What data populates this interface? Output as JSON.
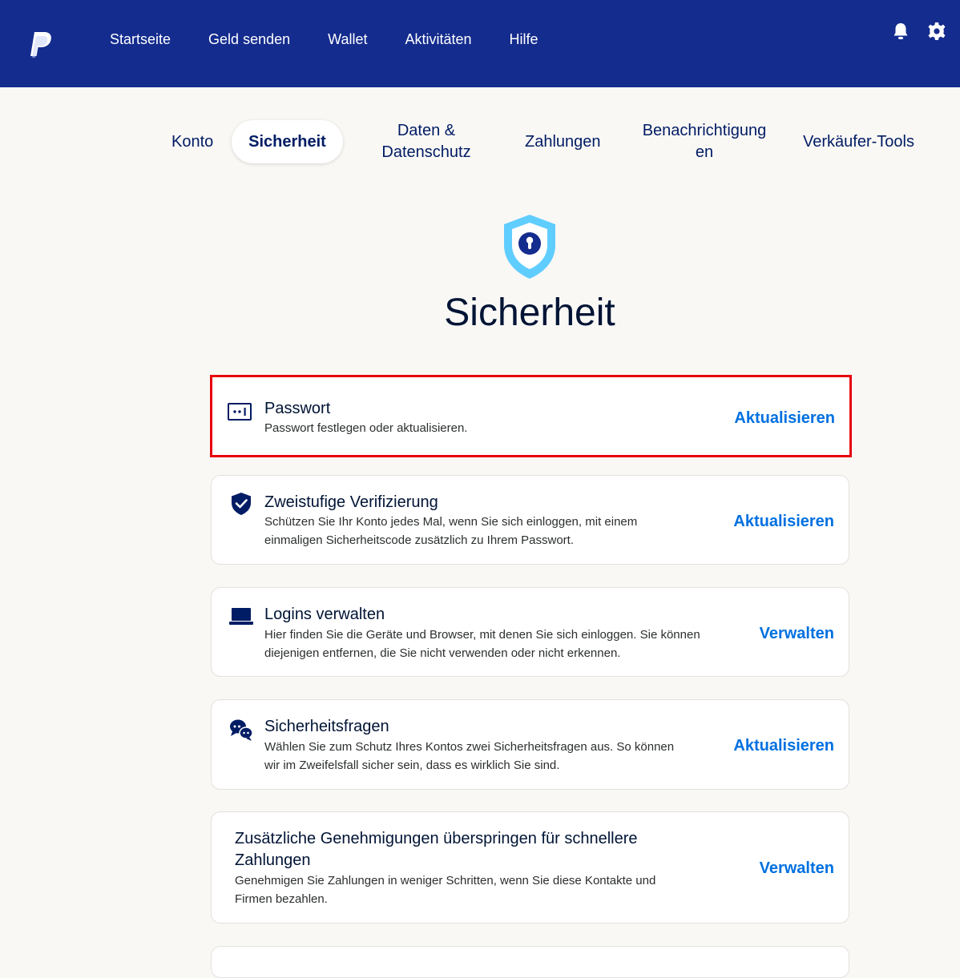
{
  "nav": {
    "items": [
      "Startseite",
      "Geld senden",
      "Wallet",
      "Aktivitäten",
      "Hilfe"
    ],
    "icons": [
      "bell-icon",
      "gear-icon"
    ]
  },
  "tabs": {
    "konto": "Konto",
    "sicherheit": "Sicherheit",
    "daten_line1": "Daten &",
    "daten_line2": "Datenschutz",
    "zahlungen": "Zahlungen",
    "benach_line1": "Benachrichtigung",
    "benach_line2": "en",
    "verkaeufer": "Verkäufer-Tools"
  },
  "hero": {
    "title": "Sicherheit",
    "icon": "shield-keyhole-icon"
  },
  "cards": [
    {
      "title": "Passwort",
      "desc": [
        "Passwort festlegen oder aktualisieren."
      ],
      "action": "Aktualisieren",
      "icon": "password-icon"
    },
    {
      "title": "Zweistufige Verifizierung",
      "desc": [
        "Schützen Sie Ihr Konto jedes Mal, wenn Sie sich einloggen, mit einem",
        "einmaligen Sicherheitscode zusätzlich zu Ihrem Passwort."
      ],
      "action": "Aktualisieren",
      "icon": "shield-check-icon"
    },
    {
      "title": "Logins verwalten",
      "desc": [
        "Hier finden Sie die Geräte und Browser, mit denen Sie sich einloggen. Sie können",
        "diejenigen entfernen, die Sie nicht verwenden oder nicht erkennen."
      ],
      "action": "Verwalten",
      "icon": "laptop-icon"
    },
    {
      "title": "Sicherheitsfragen",
      "desc": [
        "Wählen Sie zum Schutz Ihres Kontos zwei Sicherheitsfragen aus. So können",
        "wir im Zweifelsfall sicher sein, dass es wirklich Sie sind."
      ],
      "action": "Aktualisieren",
      "icon": "chat-bubbles-icon"
    },
    {
      "title_lines": [
        "Zusätzliche Genehmigungen überspringen für schnellere",
        "Zahlungen"
      ],
      "desc": [
        "Genehmigen Sie Zahlungen in weniger Schritten, wenn Sie diese Kontakte und",
        "Firmen bezahlen."
      ],
      "action": "Verwalten"
    }
  ],
  "colors": {
    "header_bg": "#142c8e",
    "link": "#0070e0",
    "highlight_border": "#e8000b",
    "shield_light": "#60cdff"
  }
}
